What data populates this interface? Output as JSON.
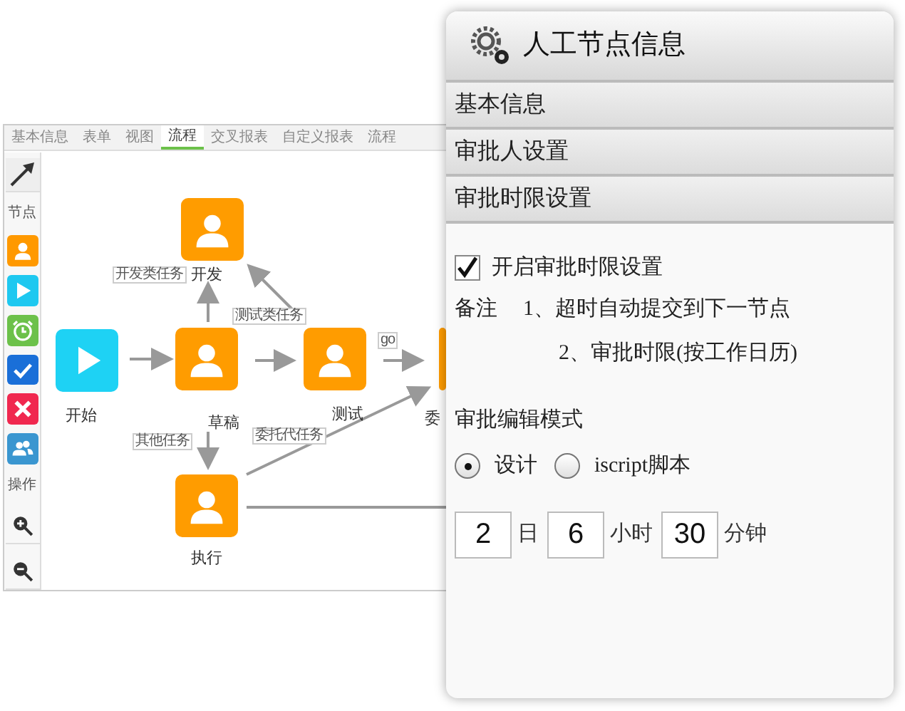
{
  "workspace": {
    "tabs": [
      {
        "label": "基本信息",
        "selected": false
      },
      {
        "label": "表单",
        "selected": false
      },
      {
        "label": "视图",
        "selected": false
      },
      {
        "label": "流程",
        "selected": true
      },
      {
        "label": "交叉报表",
        "selected": false
      },
      {
        "label": "自定义报表",
        "selected": false
      },
      {
        "label": "流程",
        "selected": false
      }
    ],
    "toolbar": [
      {
        "kind": "pointer"
      },
      {
        "kind": "label",
        "text": "节点"
      },
      {
        "kind": "tool",
        "color": "#ff9900"
      },
      {
        "kind": "tool",
        "color": "#1ec8f0"
      },
      {
        "kind": "tool",
        "color": "#6cc14a"
      },
      {
        "kind": "tool",
        "color": "#1a6fd8"
      },
      {
        "kind": "tool",
        "color": "#f0284f"
      },
      {
        "kind": "tool",
        "color": "#3a96d0"
      },
      {
        "kind": "label",
        "text": "操作"
      },
      {
        "kind": "zoom-in"
      },
      {
        "kind": "zoom-out"
      }
    ],
    "nodes": [
      {
        "kind": "start",
        "label": "开始"
      },
      {
        "kind": "task",
        "label": "开发"
      },
      {
        "kind": "task",
        "label": "草稿"
      },
      {
        "kind": "task",
        "label": "测试"
      },
      {
        "kind": "task",
        "label": "委"
      },
      {
        "kind": "task",
        "label": "执行"
      }
    ],
    "edge_labels": [
      "开发类任务",
      "测试类任务",
      "go",
      "其他任务",
      "委托代任务"
    ]
  },
  "panel": {
    "title": "人工节点信息",
    "sections": [
      "基本信息",
      "审批人设置",
      "审批时限设置"
    ],
    "enable": {
      "label": "开启审批时限设置",
      "checked": true
    },
    "notes": {
      "label": "备注",
      "lines": [
        "1、超时自动提交到下一节点",
        "2、审批时限(按工作日历)"
      ]
    },
    "mode": {
      "heading": "审批编辑模式",
      "options": [
        {
          "label": "设计",
          "selected": true
        },
        {
          "label": "iscript脚本",
          "selected": false
        }
      ]
    },
    "duration": [
      {
        "value": "2",
        "unit": "日"
      },
      {
        "value": "6",
        "unit": "小时"
      },
      {
        "value": "30",
        "unit": "分钟"
      }
    ]
  }
}
